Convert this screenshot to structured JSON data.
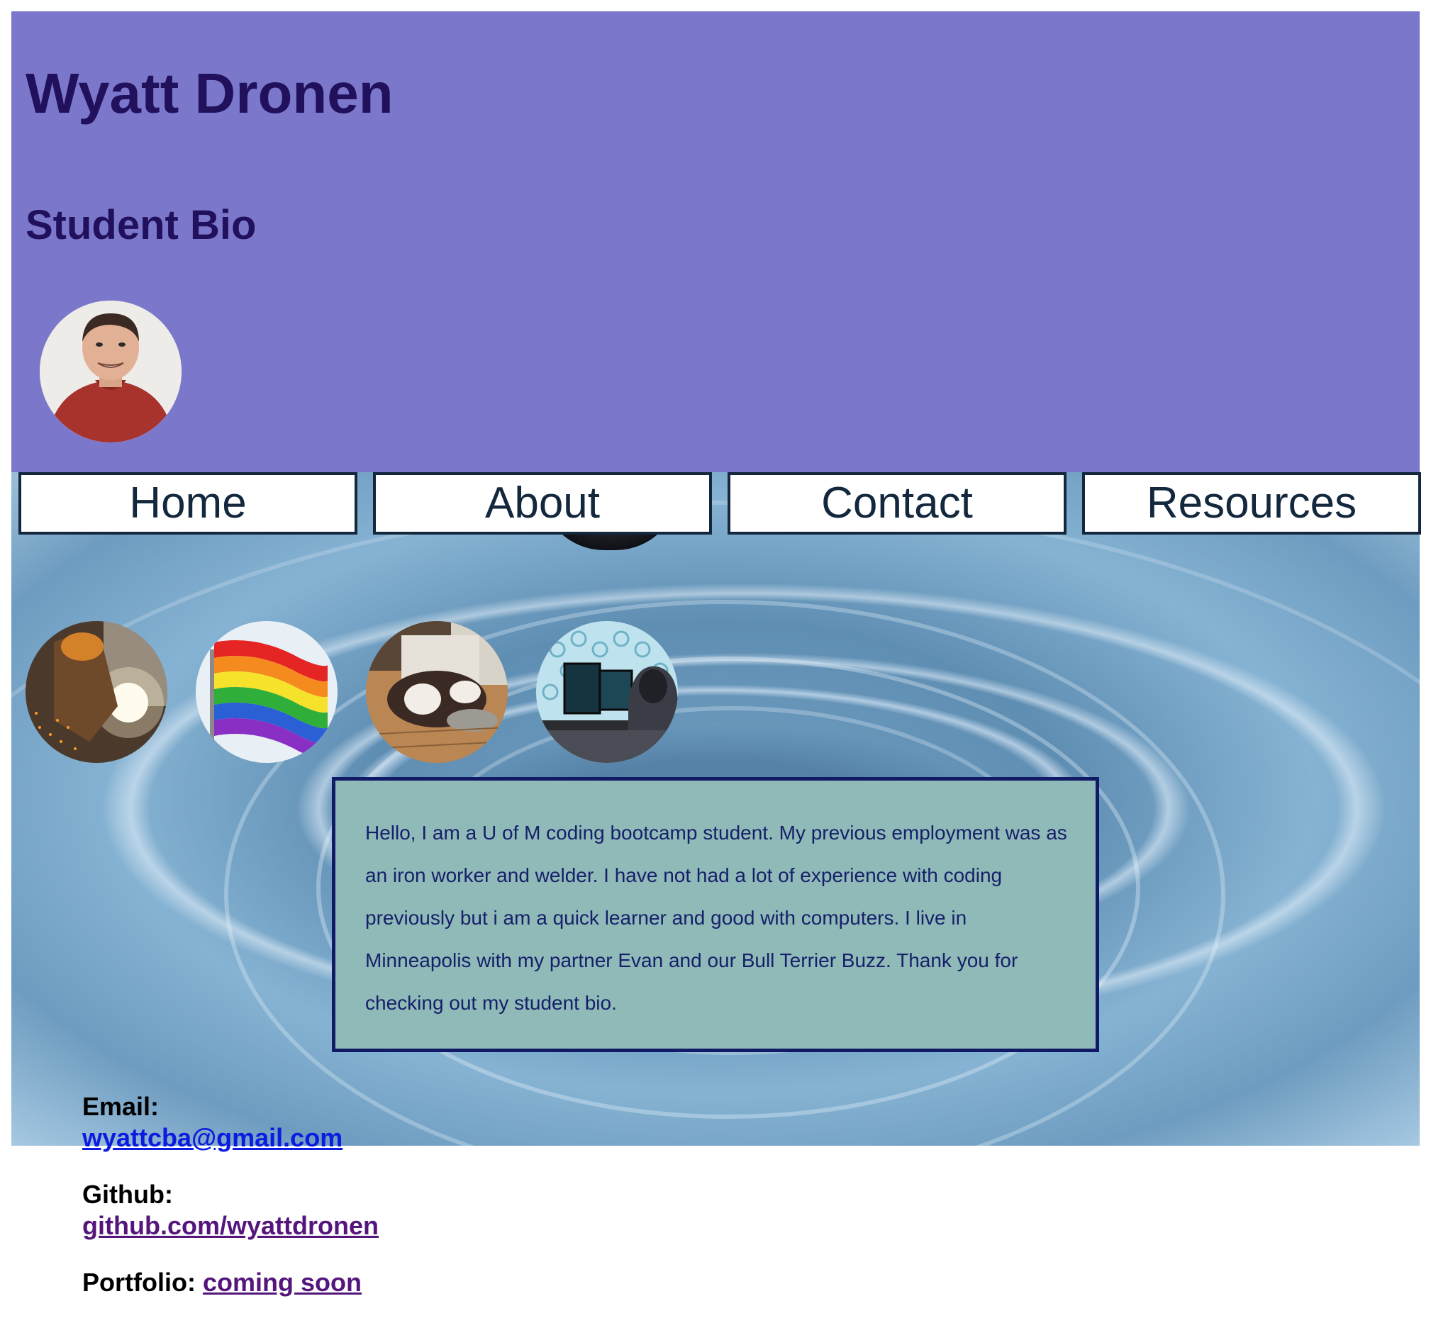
{
  "header": {
    "name": "Wyatt Dronen",
    "subtitle": "Student Bio"
  },
  "nav": {
    "items": [
      {
        "label": "Home"
      },
      {
        "label": "About"
      },
      {
        "label": "Contact"
      },
      {
        "label": "Resources"
      }
    ]
  },
  "hobbies": [
    {
      "icon": "welder-photo-icon"
    },
    {
      "icon": "rainbow-flag-icon"
    },
    {
      "icon": "bull-terrier-dog-icon"
    },
    {
      "icon": "hacker-computer-icon"
    }
  ],
  "bio": {
    "text": "Hello, I am a U of M coding bootcamp student. My previous employment was as an iron worker and welder. I have not had a lot of experience with coding previously but i am a quick learner and good with computers. I live in Minneapolis with my partner Evan and our Bull Terrier Buzz. Thank you for checking out my student bio."
  },
  "contact": {
    "email_label": "Email:",
    "email": "wyattcba@gmail.com",
    "github_label": "Github:",
    "github": "github.com/wyattdronen",
    "portfolio_label": "Portfolio:",
    "portfolio": "coming soon"
  },
  "colors": {
    "header_bg": "#7b78cc",
    "title_text": "#21105c",
    "bio_bg": "#90bab8",
    "bio_border": "#111a66",
    "nav_border": "#13273d",
    "link_unvisited": "#0b1be0",
    "link_visited": "#55167c"
  }
}
